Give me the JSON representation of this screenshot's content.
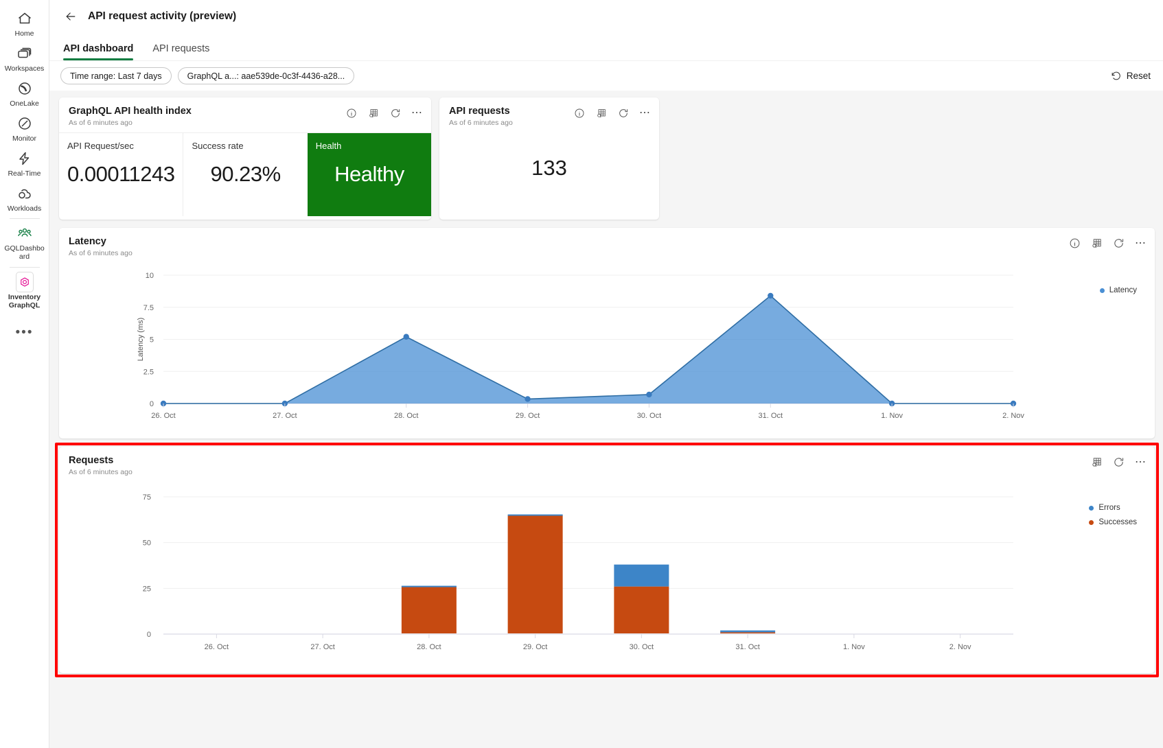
{
  "rail": {
    "items": [
      {
        "label": "Home",
        "icon": "home-icon"
      },
      {
        "label": "Workspaces",
        "icon": "workspaces-icon"
      },
      {
        "label": "OneLake",
        "icon": "onelake-icon"
      },
      {
        "label": "Monitor",
        "icon": "monitor-icon"
      },
      {
        "label": "Real-Time",
        "icon": "real-time-icon"
      },
      {
        "label": "Workloads",
        "icon": "workloads-icon"
      },
      {
        "label": "GQLDashboard",
        "icon": "people-icon"
      },
      {
        "label": "Inventory GraphQL",
        "icon": "graphql-icon"
      }
    ],
    "more_label": "•••"
  },
  "header": {
    "title": "API request activity (preview)",
    "back_icon": "back-arrow-icon",
    "tabs": [
      {
        "label": "API dashboard",
        "active": true
      },
      {
        "label": "API requests",
        "active": false
      }
    ]
  },
  "filter_bar": {
    "pills": [
      {
        "label": "Time range: Last 7 days"
      },
      {
        "label": "GraphQL a...: aae539de-0c3f-4436-a28..."
      }
    ],
    "reset_label": "Reset",
    "reset_icon": "reset-icon"
  },
  "cards": {
    "health": {
      "title": "GraphQL API health index",
      "subtitle": "As of 6 minutes ago",
      "tools": [
        "info-icon",
        "table-icon",
        "refresh-icon",
        "more-icon"
      ],
      "metrics": [
        {
          "label": "API Request/sec",
          "value": "0.00011243"
        },
        {
          "label": "Success rate",
          "value": "90.23%"
        },
        {
          "label": "Health",
          "value": "Healthy",
          "color": "#107c10"
        }
      ]
    },
    "api_requests": {
      "title": "API requests",
      "subtitle": "As of 6 minutes ago",
      "tools": [
        "info-icon",
        "table-icon",
        "refresh-icon",
        "more-icon"
      ],
      "value": "133"
    },
    "latency": {
      "title": "Latency",
      "subtitle": "As of 6 minutes ago",
      "tools": [
        "info-icon",
        "table-icon",
        "refresh-icon",
        "more-icon"
      ],
      "legend": [
        {
          "label": "Latency",
          "color": "#4a8fd4"
        }
      ]
    },
    "requests": {
      "title": "Requests",
      "subtitle": "As of 6 minutes ago",
      "tools": [
        "table-icon",
        "refresh-icon",
        "more-icon"
      ],
      "legend": [
        {
          "label": "Errors",
          "color": "#3d85c8"
        },
        {
          "label": "Successes",
          "color": "#c64a11"
        }
      ]
    }
  },
  "chart_data": [
    {
      "type": "area",
      "title": "Latency",
      "xlabel": "",
      "ylabel": "Latency (ms)",
      "categories": [
        "26. Oct",
        "27. Oct",
        "28. Oct",
        "29. Oct",
        "30. Oct",
        "31. Oct",
        "1. Nov",
        "2. Nov"
      ],
      "ytick_labels": [
        "0",
        "2.5",
        "5",
        "7.5",
        "10"
      ],
      "ylim": [
        0,
        10
      ],
      "grid": true,
      "legend_position": "right",
      "series": [
        {
          "name": "Latency",
          "color": "#4a8fd4",
          "values": [
            0,
            0,
            5.2,
            0.35,
            0.7,
            8.4,
            0,
            0
          ]
        }
      ]
    },
    {
      "type": "bar",
      "title": "Requests",
      "stacked": true,
      "xlabel": "",
      "ylabel": "",
      "categories": [
        "26. Oct",
        "27. Oct",
        "28. Oct",
        "29. Oct",
        "30. Oct",
        "31. Oct",
        "1. Nov",
        "2. Nov"
      ],
      "ytick_labels": [
        "0",
        "25",
        "50",
        "75"
      ],
      "ylim": [
        0,
        75
      ],
      "grid": true,
      "legend_position": "right",
      "series": [
        {
          "name": "Successes",
          "color": "#c64a11",
          "values": [
            0,
            0,
            26,
            65,
            26,
            1,
            0,
            0
          ]
        },
        {
          "name": "Errors",
          "color": "#3d85c8",
          "values": [
            0,
            0,
            0.4,
            0.4,
            12,
            1,
            0,
            0
          ]
        }
      ]
    }
  ]
}
